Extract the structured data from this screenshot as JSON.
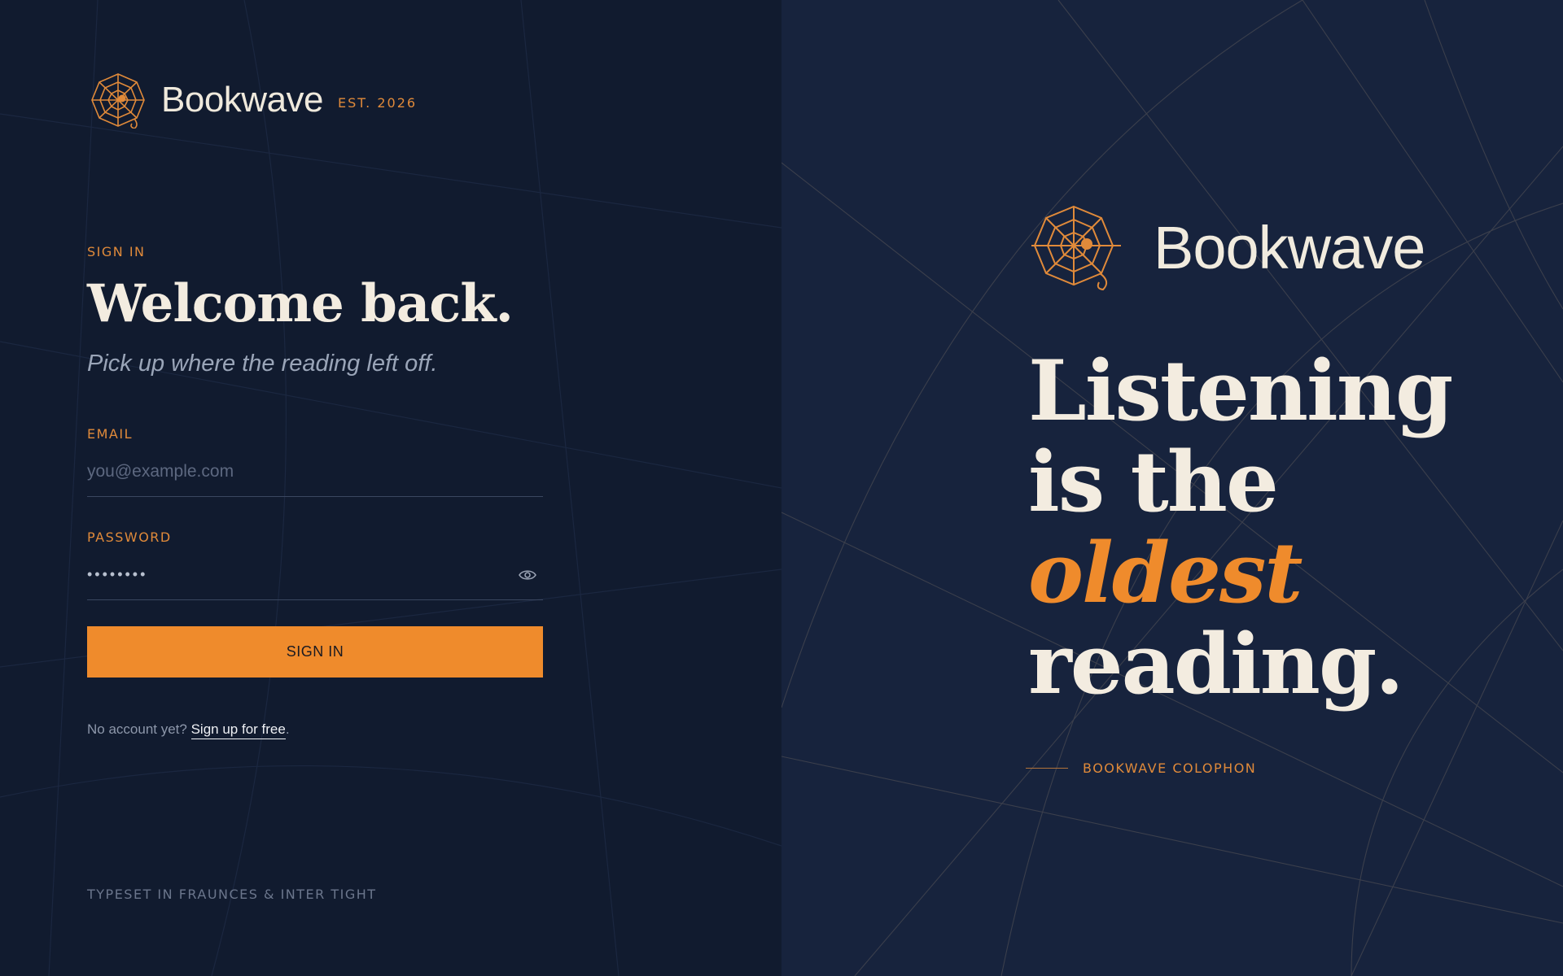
{
  "brand": {
    "name": "Bookwave",
    "est": "EST. 2026",
    "logo_icon": "spider-web-icon"
  },
  "signin": {
    "eyebrow": "SIGN IN",
    "headline": "Welcome back.",
    "subhead": "Pick up where the reading left off.",
    "email_label": "EMAIL",
    "email_placeholder": "you@example.com",
    "password_label": "PASSWORD",
    "password_value": "password",
    "toggle_icon": "eye-icon",
    "submit_label": "SIGN IN",
    "signup_prompt": "No account yet?",
    "signup_link": "Sign up for free",
    "signup_suffix": "."
  },
  "footer": {
    "note": "TYPESET IN FRAUNCES & INTER TIGHT"
  },
  "hero": {
    "brand_name": "Bookwave",
    "line1": "Listening",
    "line2": "is the",
    "line3_accent": "oldest",
    "line4": "reading.",
    "colophon": "BOOKWAVE COLOPHON"
  },
  "colors": {
    "left_bg": "#111b2f",
    "right_bg": "#17233d",
    "accent": "#ef8b2c",
    "cream": "#f3ece0"
  }
}
